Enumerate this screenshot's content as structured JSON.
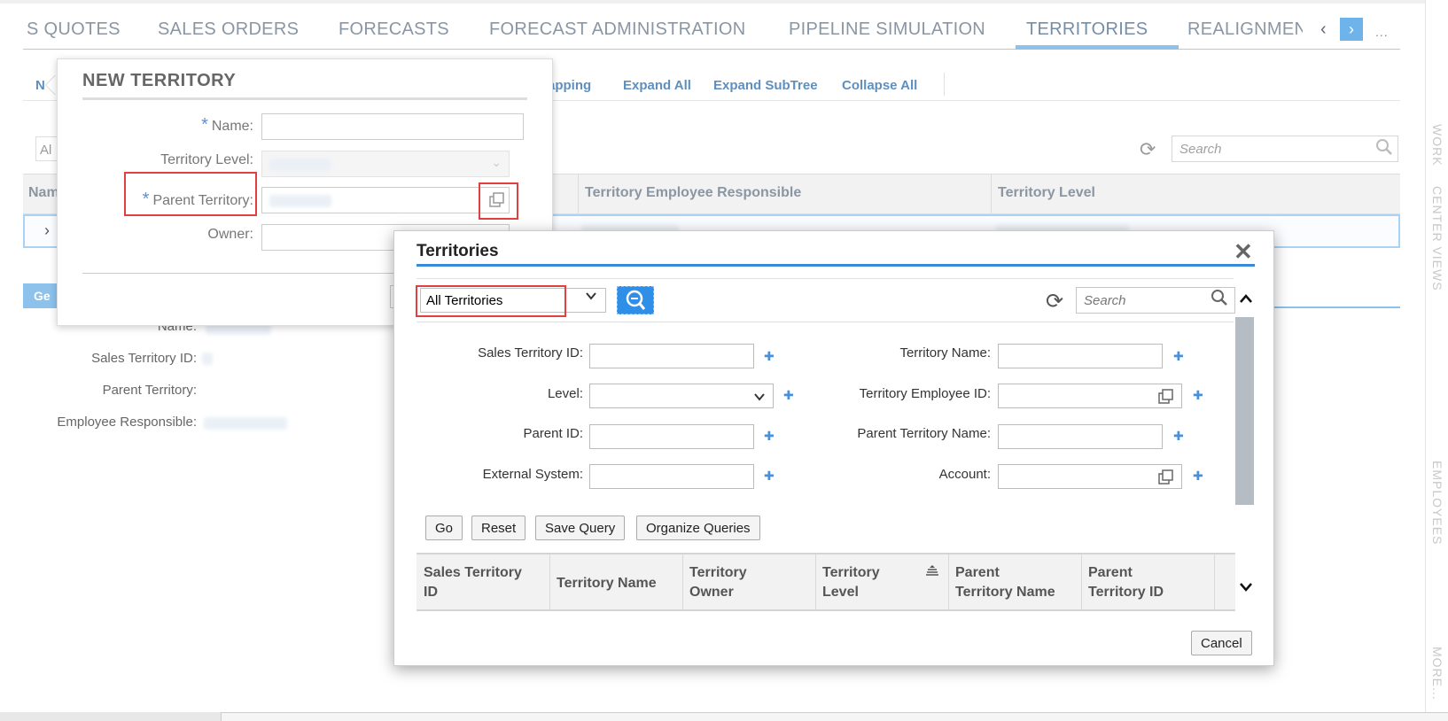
{
  "nav": {
    "tabs": [
      "S QUOTES",
      "SALES ORDERS",
      "FORECASTS",
      "FORECAST ADMINISTRATION",
      "PIPELINE SIMULATION",
      "TERRITORIES",
      "REALIGNMEN"
    ],
    "active": "TERRITORIES",
    "more": "...",
    "prev_arrow": "‹",
    "next_arrow": "›"
  },
  "rail": {
    "labels": [
      "WORK",
      "CENTER VIEWS",
      "EMPLOYEES",
      "MORE..."
    ]
  },
  "toolbar": {
    "first": "N",
    "links": [
      "apping",
      "Expand All",
      "Expand SubTree",
      "Collapse All"
    ]
  },
  "list": {
    "select": "Al",
    "search_placeholder": "Search",
    "columns": [
      "Nam",
      "Territory Employee Responsible",
      "Territory Level"
    ]
  },
  "details": {
    "tab": "Ge",
    "labels": [
      "Name:",
      "Sales Territory ID:",
      "Parent Territory:",
      "Employee Responsible:"
    ]
  },
  "popover": {
    "title": "NEW TERRITORY",
    "name_label": "Name:",
    "level_label": "Territory Level:",
    "parent_label": "Parent Territory:",
    "owner_label": "Owner:"
  },
  "dialog": {
    "title": "Territories",
    "close": "✕",
    "query_select": "All Territories",
    "search_placeholder": "Search",
    "fields_left": [
      "Sales Territory ID:",
      "Level:",
      "Parent ID:",
      "External System:"
    ],
    "fields_right": [
      "Territory Name:",
      "Territory Employee ID:",
      "Parent Territory Name:",
      "Account:"
    ],
    "buttons": [
      "Go",
      "Reset",
      "Save Query",
      "Organize Queries"
    ],
    "columns": [
      {
        "l1": "Sales Territory",
        "l2": "ID"
      },
      {
        "l1": "Territory Name",
        "l2": ""
      },
      {
        "l1": "Territory",
        "l2": "Owner"
      },
      {
        "l1": "Territory",
        "l2": "Level"
      },
      {
        "l1": "Parent",
        "l2": "Territory Name"
      },
      {
        "l1": "Parent",
        "l2": "Territory ID"
      }
    ],
    "cancel": "Cancel"
  },
  "colors": {
    "accent": "#3a8ad9",
    "highlight": "#e04040",
    "tab_inactive": "#8a96a3"
  }
}
